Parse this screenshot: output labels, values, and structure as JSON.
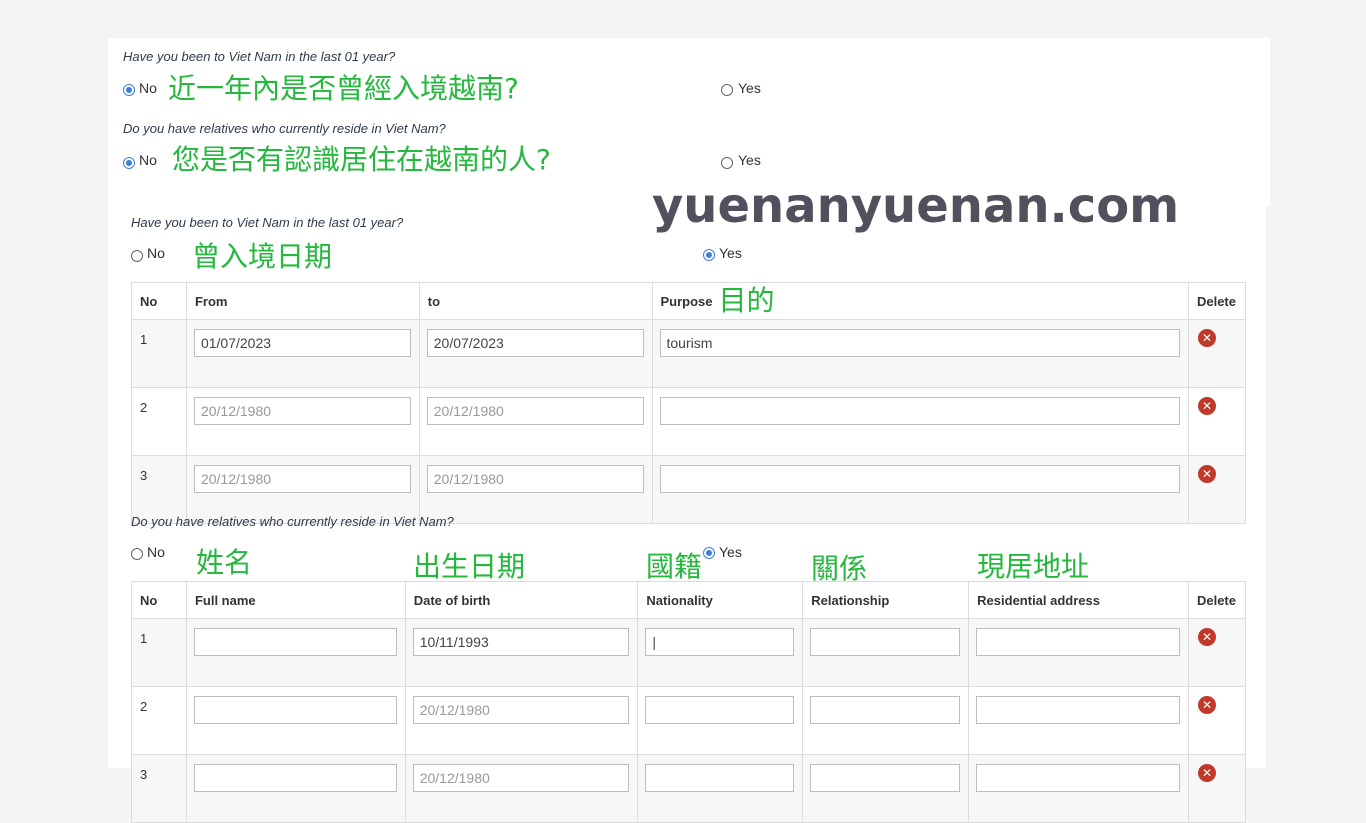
{
  "watermark": "yuenanyuenan.com",
  "top": {
    "q1": "Have you been to Viet Nam in the last 01 year?",
    "q1_note": "近一年內是否曾經入境越南?",
    "q2": "Do you have relatives who currently reside in Viet Nam?",
    "q2_note": "您是否有認識居住在越南的人?",
    "no": "No",
    "yes": "Yes"
  },
  "visits": {
    "question": "Have you been to Viet Nam in the last 01 year?",
    "no": "No",
    "yes": "Yes",
    "date_note": "曾入境日期",
    "purpose_note": "目的",
    "headers": {
      "no": "No",
      "from": "From",
      "to": "to",
      "purpose": "Purpose",
      "delete": "Delete"
    },
    "rows": [
      {
        "no": "1",
        "from": "01/07/2023",
        "to": "20/07/2023",
        "purpose": "tourism"
      },
      {
        "no": "2",
        "from": "",
        "to": "",
        "purpose": ""
      },
      {
        "no": "3",
        "from": "",
        "to": "",
        "purpose": ""
      }
    ],
    "date_placeholder": "20/12/1980"
  },
  "relatives": {
    "question": "Do you have relatives who currently reside in Viet Nam?",
    "no": "No",
    "yes": "Yes",
    "notes": {
      "name": "姓名",
      "dob": "出生日期",
      "nationality": "國籍",
      "relationship": "關係",
      "address": "現居地址"
    },
    "headers": {
      "no": "No",
      "full_name": "Full name",
      "dob": "Date of birth",
      "nationality": "Nationality",
      "relationship": "Relationship",
      "address": "Residential address",
      "delete": "Delete"
    },
    "rows": [
      {
        "no": "1",
        "full_name": "",
        "dob": "10/11/1993",
        "nationality": "|",
        "relationship": "",
        "address": ""
      },
      {
        "no": "2",
        "full_name": "",
        "dob": "",
        "nationality": "",
        "relationship": "",
        "address": ""
      },
      {
        "no": "3",
        "full_name": "",
        "dob": "",
        "nationality": "",
        "relationship": "",
        "address": ""
      }
    ],
    "date_placeholder": "20/12/1980"
  },
  "delete_icon": "circle-x-icon",
  "colors": {
    "radio_selected": "#3d7fd6",
    "delete": "#c0392b",
    "annotation": "#26b83e",
    "watermark": "#52505c"
  }
}
